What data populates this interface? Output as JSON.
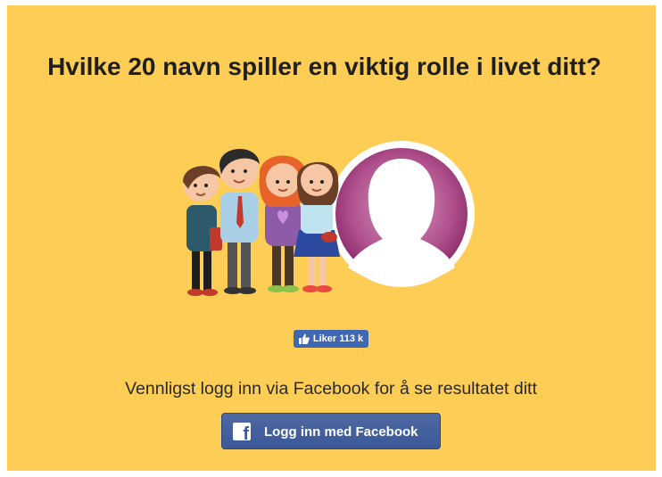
{
  "quiz": {
    "title": "Hvilke 20 navn spiller en viktig rolle i livet ditt?"
  },
  "like_button": {
    "label": "Liker 113 k",
    "icon": "thumbs-up-icon",
    "color": "#4267b2"
  },
  "login": {
    "prompt": "Vennligst logg inn via Facebook for å se resultatet ditt",
    "button_label": "Logg inn med Facebook",
    "icon": "facebook-logo-icon",
    "button_color": "#4267b2"
  },
  "colors": {
    "background": "#fecd55",
    "avatar_ring": "#9e3a7a"
  }
}
